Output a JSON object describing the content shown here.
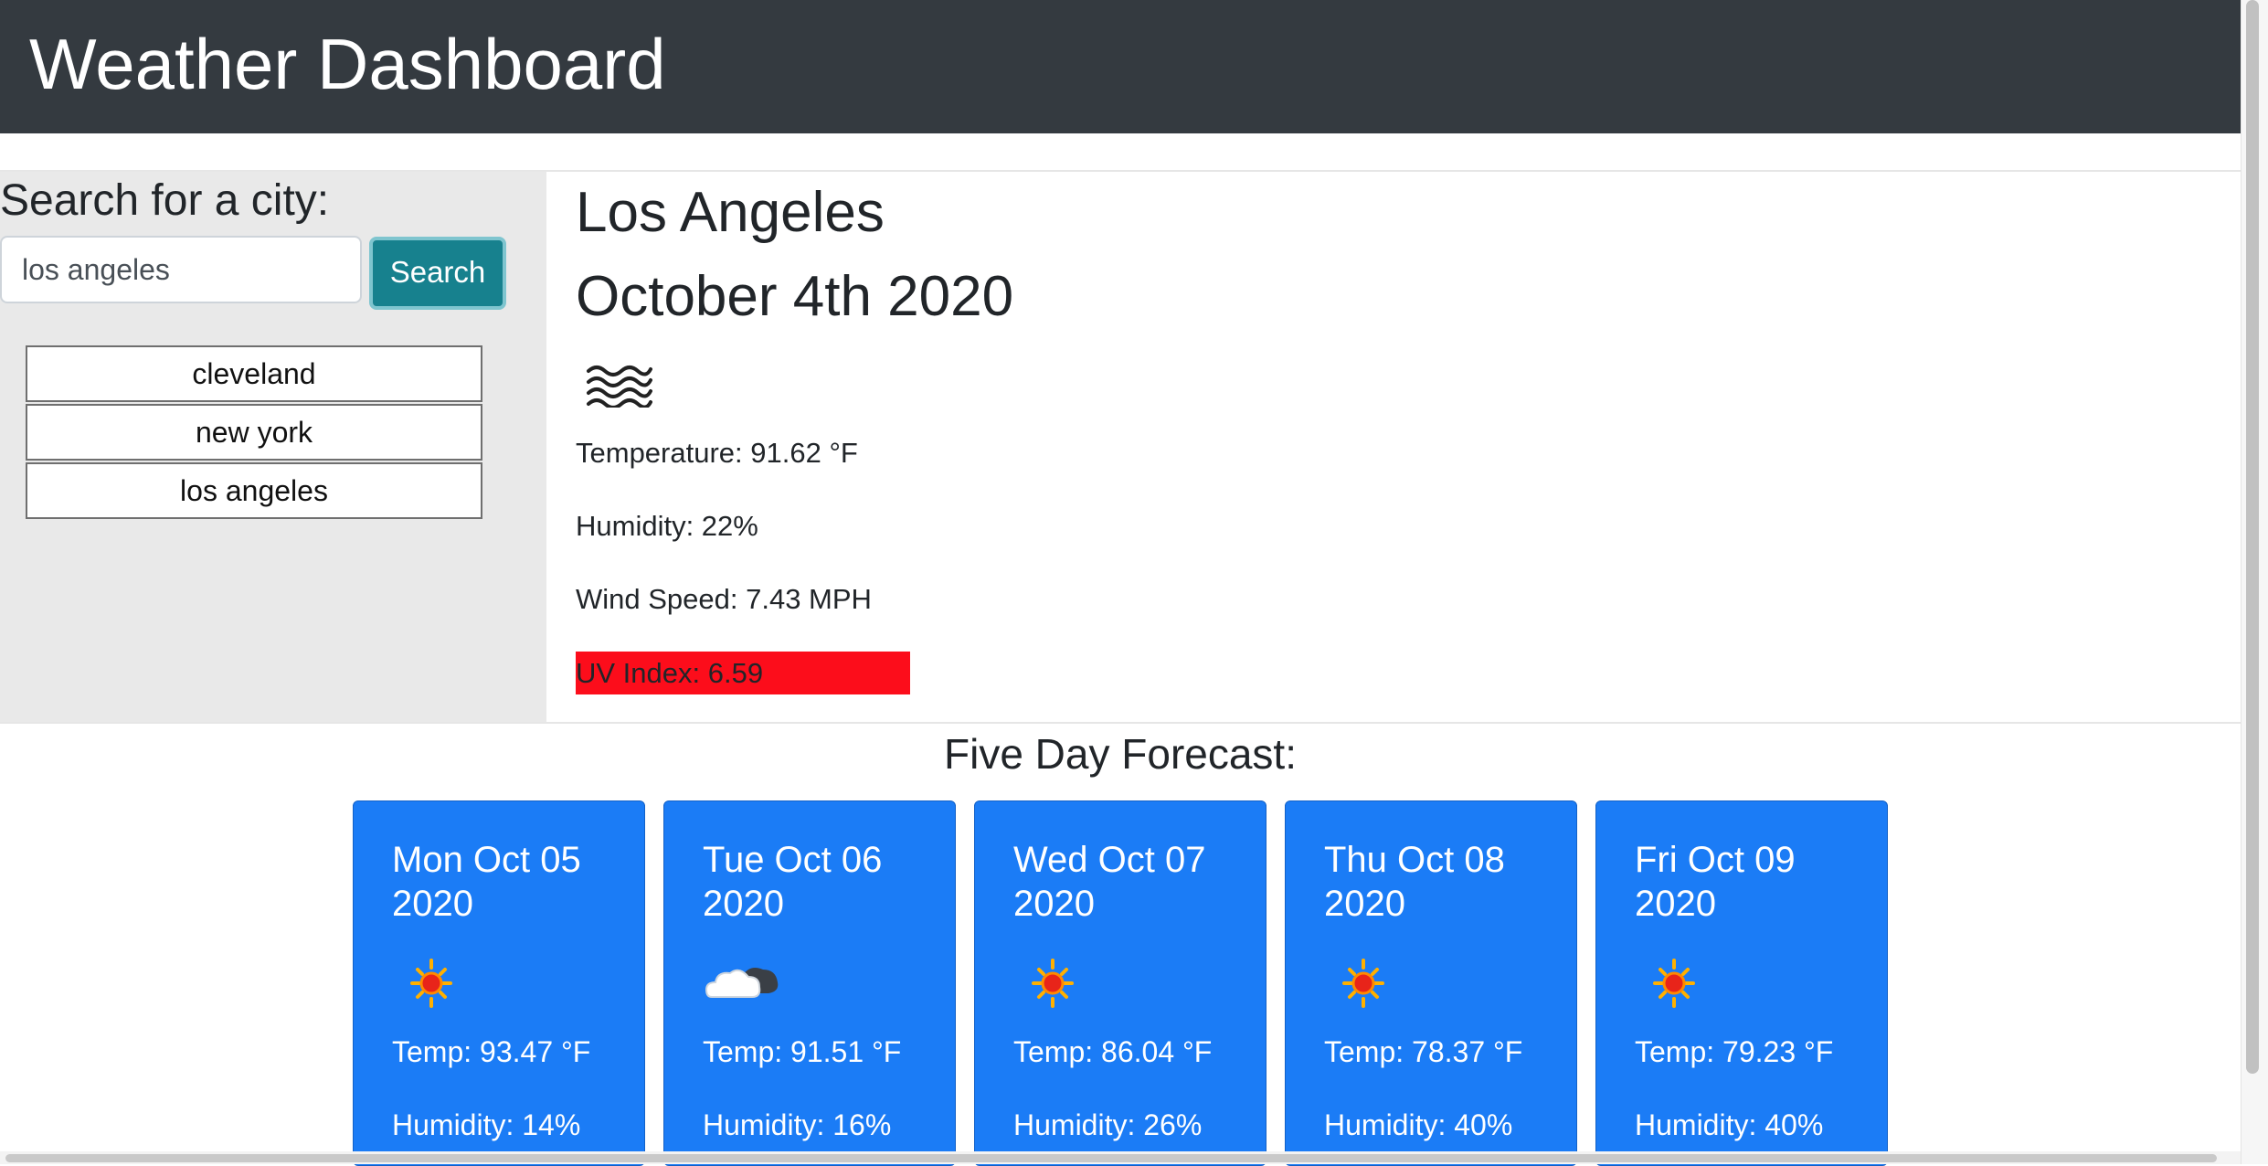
{
  "header": {
    "title": "Weather Dashboard"
  },
  "search": {
    "label": "Search for a city:",
    "input_value": "los angeles",
    "button_label": "Search"
  },
  "history": [
    "cleveland",
    "new york",
    "los angeles"
  ],
  "current": {
    "city": "Los Angeles",
    "date": "October 4th 2020",
    "icon": "haze-icon",
    "temperature": "Temperature: 91.62 °F",
    "humidity": "Humidity: 22%",
    "wind": "Wind Speed: 7.43 MPH",
    "uv": "UV Index: 6.59",
    "uv_color": "#fc0d1b"
  },
  "forecast": {
    "title": "Five Day Forecast:",
    "card_color": "#1b7cf6",
    "days": [
      {
        "date": "Mon Oct 05 2020",
        "icon": "sun-icon",
        "temp": "Temp: 93.47 °F",
        "humidity": "Humidity: 14%"
      },
      {
        "date": "Tue Oct 06 2020",
        "icon": "cloud-icon",
        "temp": "Temp: 91.51 °F",
        "humidity": "Humidity: 16%"
      },
      {
        "date": "Wed Oct 07 2020",
        "icon": "sun-icon",
        "temp": "Temp: 86.04 °F",
        "humidity": "Humidity: 26%"
      },
      {
        "date": "Thu Oct 08 2020",
        "icon": "sun-icon",
        "temp": "Temp: 78.37 °F",
        "humidity": "Humidity: 40%"
      },
      {
        "date": "Fri Oct 09 2020",
        "icon": "sun-icon",
        "temp": "Temp: 79.23 °F",
        "humidity": "Humidity: 40%"
      }
    ]
  }
}
